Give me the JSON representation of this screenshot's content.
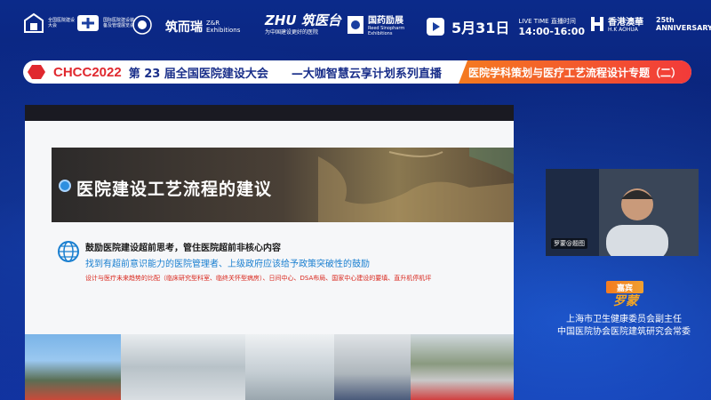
{
  "logos": {
    "conf_tiny": "全国医院建设大会",
    "expo_tiny": "国际医院建设装备及管理展览会",
    "zr_brand": "筑而瑞",
    "zr_en": "Z&R Exhibitions",
    "zhu_brand": "ZHU 筑医台",
    "zhu_tagline": "为中国建设更好的医院",
    "sinopharm_cn": "国药励展",
    "sinopharm_en": "Reed Sinopharm Exhibitions",
    "hkaohua_cn": "香港澳華",
    "hkaohua_en": "H.K AOHUA",
    "anniversary": "25th ANNIVERSARY"
  },
  "live": {
    "date": "5月31日",
    "label": "LIVE TIME 直播时间",
    "time": "14:00-16:00"
  },
  "banner": {
    "chcc": "CHCC2022",
    "conference": "第 23 届全国医院建设大会",
    "series": "—大咖智慧云享计划系列直播",
    "special": "医院学科策划与医疗工艺流程设计专题（二）"
  },
  "slide": {
    "title": "医院建设工艺流程的建议",
    "line1": "鼓励医院建设超前思考，管住医院超前非核心内容",
    "line2": "找到有超前意识能力的医院管理者、上级政府应该给予政策突破性的鼓励",
    "line3": "设计与医疗未来趋势的比配（临床研究型科室、临终关怀型病房）、日间中心、DSA布局、国家中心建设的要填、直升机停机坪"
  },
  "guest": {
    "video_tag": "罗蒙@题图",
    "badge": "嘉宾",
    "name": "罗蒙",
    "title1": "上海市卫生健康委员会副主任",
    "title2": "中国医院协会医院建筑研究会常委"
  },
  "colors": {
    "background": "#0a1f6e",
    "accent_red": "#e0282e",
    "accent_orange": "#f47b20",
    "navy_text": "#1a2f8a",
    "guest_name": "#f5a623"
  }
}
